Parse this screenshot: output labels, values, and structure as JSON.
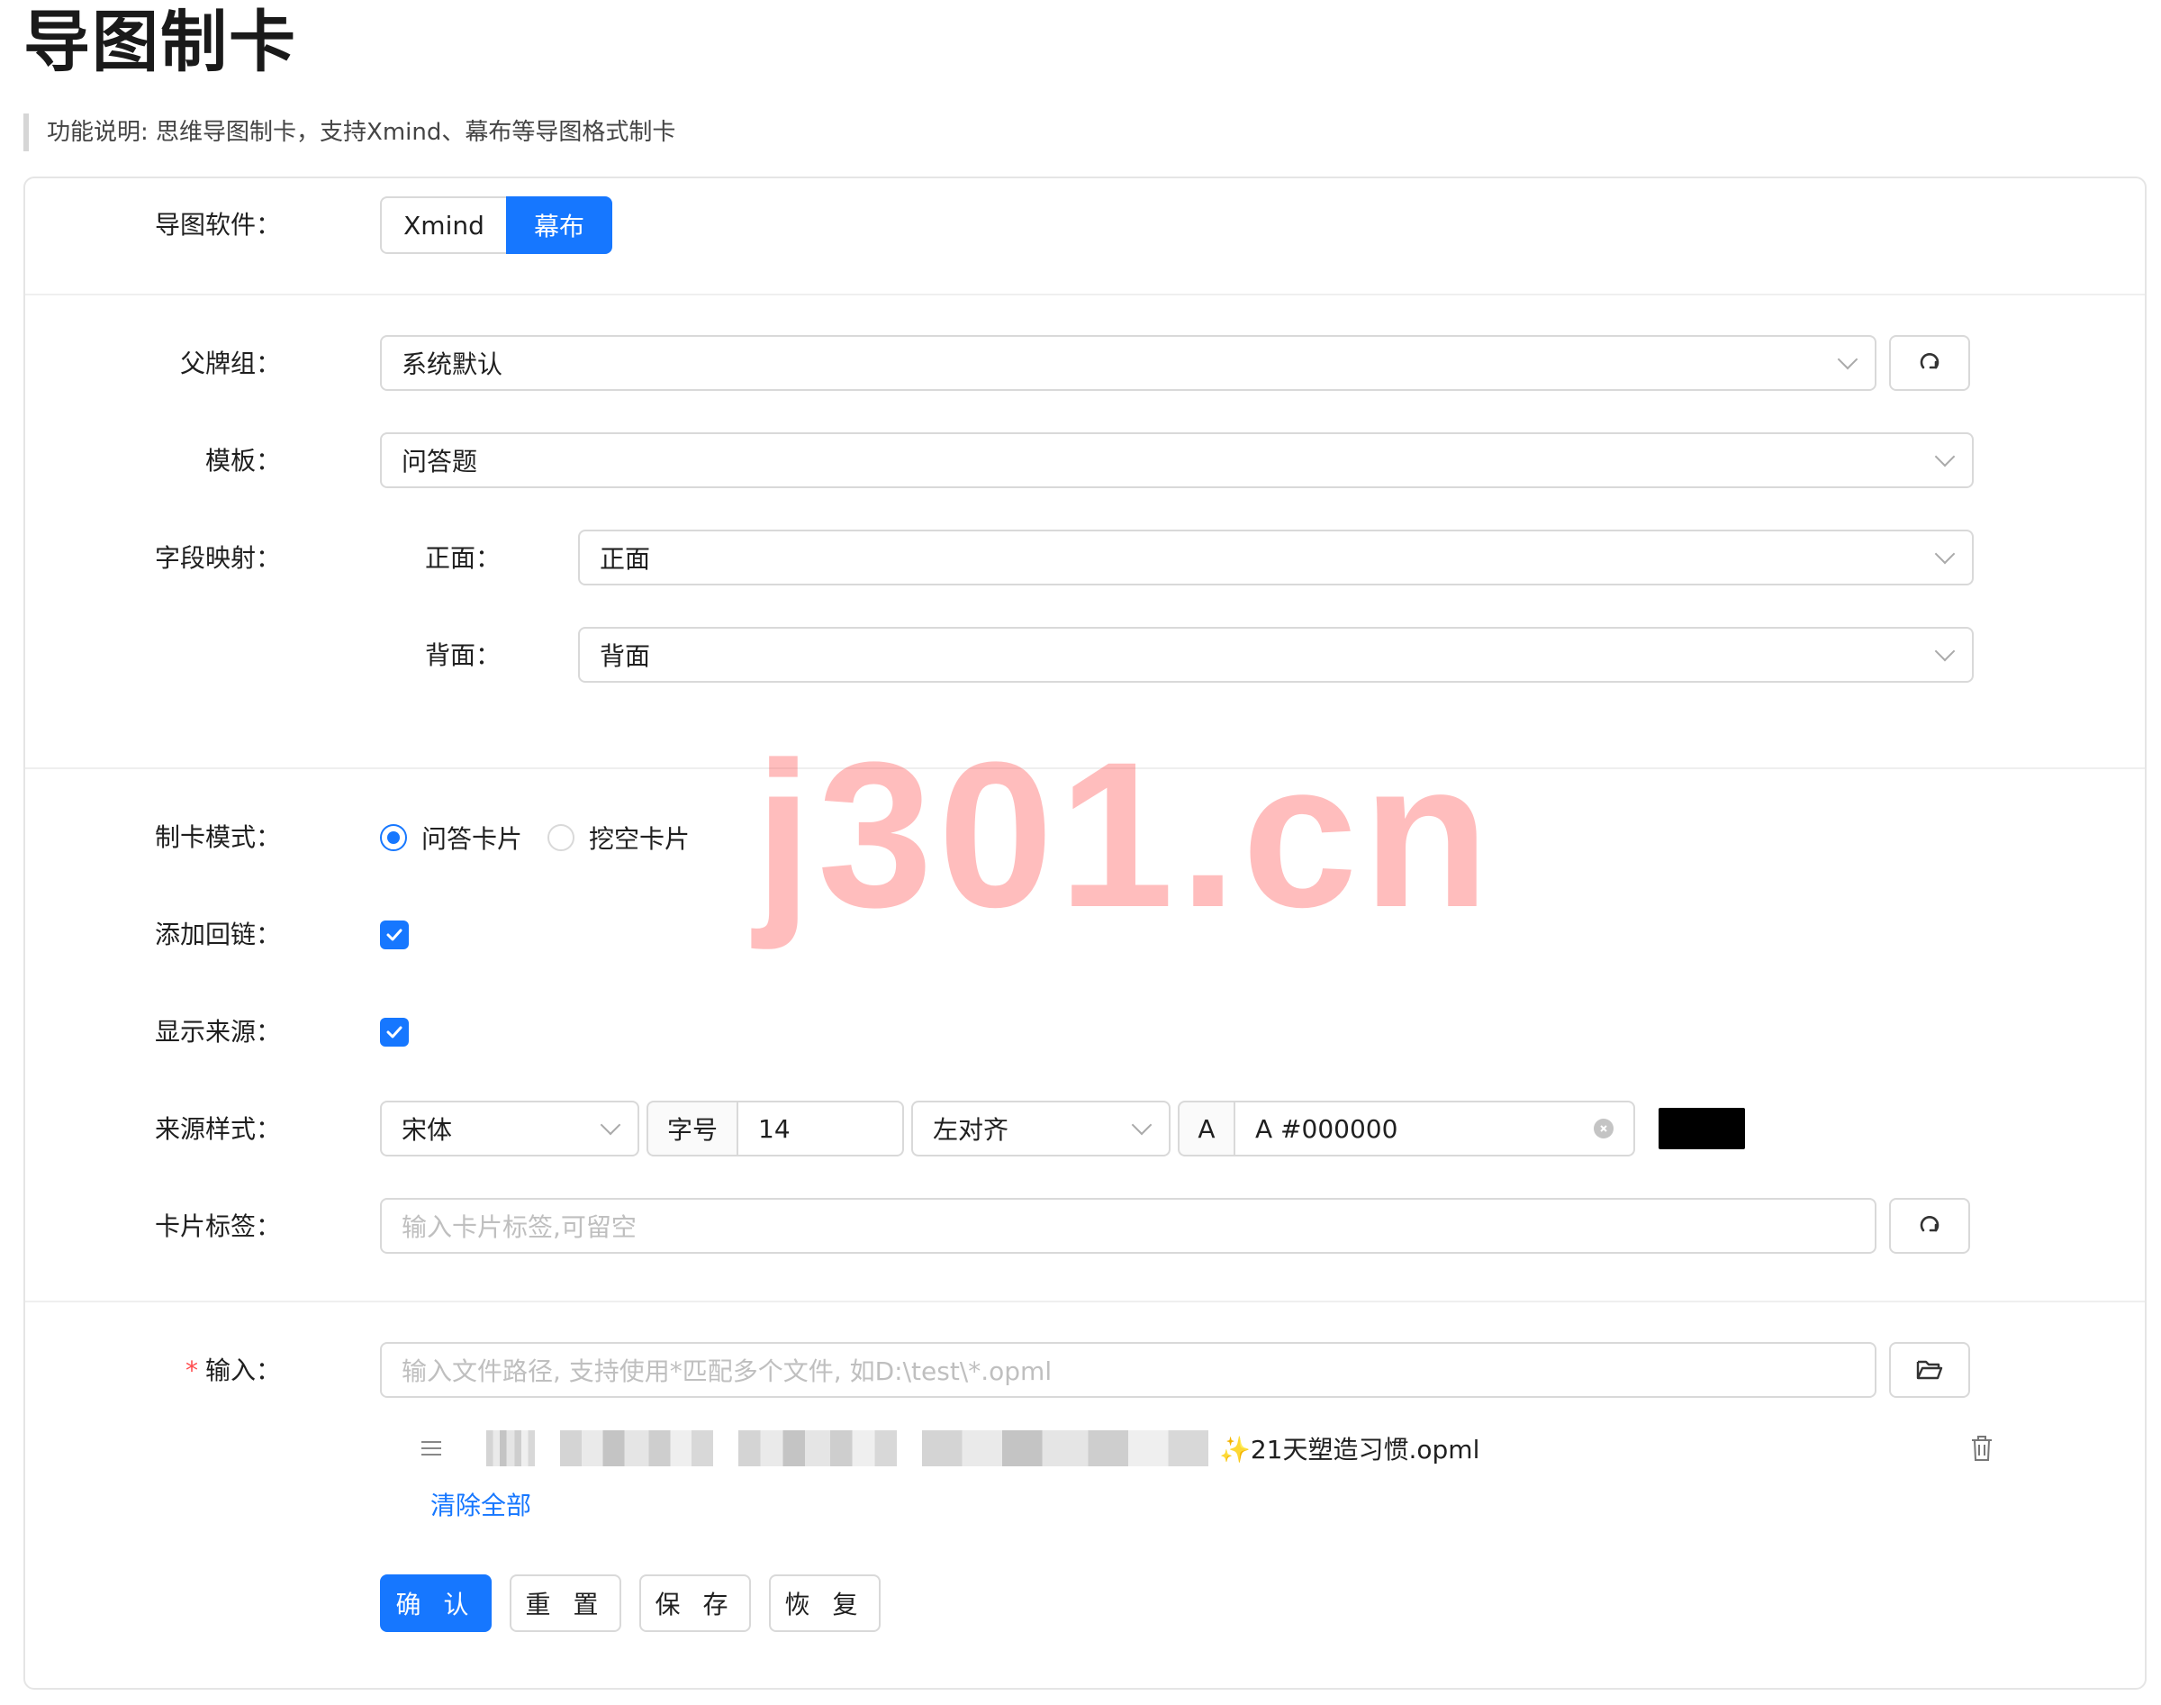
{
  "page": {
    "title": "导图制卡",
    "description": "功能说明: 思维导图制卡，支持Xmind、幕布等导图格式制卡"
  },
  "software": {
    "label": "导图软件：",
    "options": [
      "Xmind",
      "幕布"
    ],
    "selected": "幕布"
  },
  "deck": {
    "label": "父牌组：",
    "value": "系统默认"
  },
  "template": {
    "label": "模板：",
    "value": "问答题"
  },
  "field_mapping": {
    "label": "字段映射：",
    "front_label": "正面：",
    "front_value": "正面",
    "back_label": "背面：",
    "back_value": "背面"
  },
  "card_mode": {
    "label": "制卡模式：",
    "options": [
      "问答卡片",
      "挖空卡片"
    ],
    "selected": "问答卡片"
  },
  "add_backlink": {
    "label": "添加回链：",
    "checked": true
  },
  "show_source": {
    "label": "显示来源：",
    "checked": true
  },
  "source_style": {
    "label": "来源样式：",
    "font": "宋体",
    "size_label": "字号",
    "size_value": "14",
    "align": "左对齐",
    "color_prefix": "A",
    "color_value": "A #000000",
    "color_swatch": "#000000"
  },
  "card_tags": {
    "label": "卡片标签：",
    "placeholder": "输入卡片标签,可留空"
  },
  "input": {
    "required_mark": "*",
    "label": "输入：",
    "placeholder": "输入文件路径, 支持使用*匹配多个文件, 如D:\\test\\*.opml",
    "file_name": "✨21天塑造习惯.opml",
    "clear_all": "清除全部"
  },
  "actions": {
    "confirm": "确 认",
    "reset": "重 置",
    "save": "保 存",
    "restore": "恢 复"
  },
  "watermark": "j301.cn",
  "colors": {
    "accent": "#1677ff",
    "required": "#ff4d4f",
    "watermark": "#ff3b3b"
  }
}
